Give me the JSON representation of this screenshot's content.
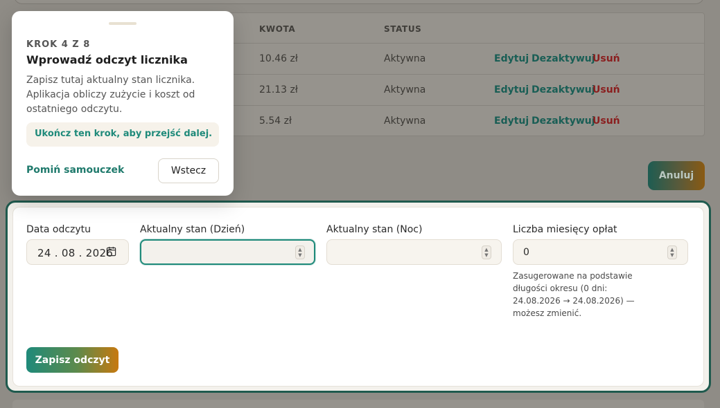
{
  "table": {
    "headers": {
      "amount": "KWOTA",
      "status": "STATUS"
    },
    "rows": [
      {
        "amount": "10.46 zł",
        "status": "Aktywna",
        "edit": "Edytuj",
        "deactivate": "Dezaktywuj",
        "delete": "Usuń"
      },
      {
        "amount": "21.13 zł",
        "status": "Aktywna",
        "edit": "Edytuj",
        "deactivate": "Dezaktywuj",
        "delete": "Usuń"
      },
      {
        "amount": "5.54 zł",
        "status": "Aktywna",
        "edit": "Edytuj",
        "deactivate": "Dezaktywuj",
        "delete": "Usuń"
      }
    ]
  },
  "cancel_button": "Anuluj",
  "form": {
    "date_label": "Data odczytu",
    "date_value": "24 . 08 . 2026",
    "day_label": "Aktualny stan (Dzień)",
    "day_value": "",
    "night_label": "Aktualny stan (Noc)",
    "night_value": "",
    "months_label": "Liczba miesięcy opłat",
    "months_value": "0",
    "months_hint": "Zasugerowane na podstawie długości okresu (0 dni: 24.08.2026 → 24.08.2026) — możesz zmienić.",
    "save_button": "Zapisz odczyt"
  },
  "tour": {
    "step": "KROK 4 Z 8",
    "title": "Wprowadź odczyt licznika",
    "body": "Zapisz tutaj aktualny stan licznika. Aplikacja obliczy zużycie i koszt od ostatniego odczytu.",
    "notice": "Ukończ ten krok, aby przejść dalej.",
    "skip": "Pomiń samouczek",
    "back": "Wstecz"
  },
  "colors": {
    "accent": "#1f8a7a",
    "outline": "#1f5a4e",
    "danger": "#c62828",
    "gradient_end": "#c7790f"
  }
}
